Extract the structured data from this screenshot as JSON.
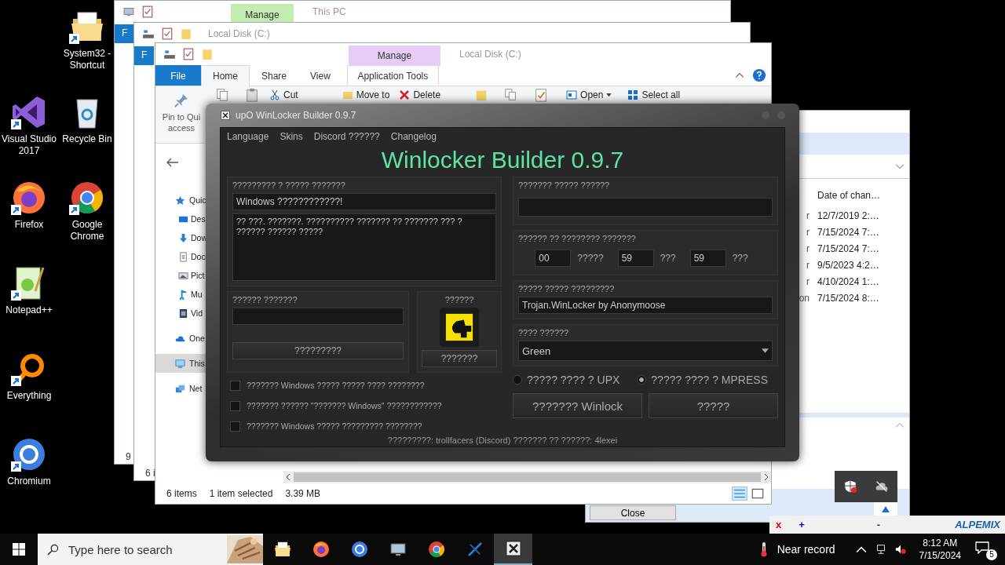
{
  "desktop_icons": [
    {
      "kind": "folder",
      "label": "System32 - Shortcut"
    },
    {
      "kind": "visual-studio",
      "label": "Visual Studio 2017"
    },
    {
      "kind": "recycle-bin",
      "label": "Recycle Bin"
    },
    {
      "kind": "firefox",
      "label": "Firefox"
    },
    {
      "kind": "chrome",
      "label": "Google Chrome"
    },
    {
      "kind": "notepad",
      "label": "Notepad++"
    },
    {
      "kind": "search-ring",
      "label": "Everything"
    },
    {
      "kind": "chromium",
      "label": "Chromium"
    }
  ],
  "back_window_1": {
    "contextual_tab": "Manage",
    "title": "This PC",
    "file_tab": "F",
    "status": "9"
  },
  "back_window_2": {
    "title": "Local Disk (C:)",
    "file_tab": "F",
    "status": "6 i"
  },
  "right_window": {
    "column": "Date of chan…",
    "type_fragments": [
      "r",
      "r",
      "r",
      "r",
      "r",
      "on"
    ],
    "dates": [
      "12/7/2019 2:…",
      "7/15/2024 7:…",
      "7/15/2024 7:…",
      "9/5/2023 4:2…",
      "4/10/2024 1:…",
      "7/15/2024 8:…"
    ],
    "close_button": "Close"
  },
  "explorer": {
    "contextual_tab": "Manage",
    "title": "Local Disk (C:)",
    "tabs": [
      {
        "label": "File",
        "kind": "file",
        "selected": false
      },
      {
        "label": "Home",
        "kind": "tab",
        "selected": true
      },
      {
        "label": "Share",
        "kind": "tab",
        "selected": false
      },
      {
        "label": "View",
        "kind": "tab",
        "selected": false
      },
      {
        "label": "Application Tools",
        "kind": "tab",
        "selected": false
      }
    ],
    "ribbon": {
      "pin": "Pin to Qui",
      "pin_line2": "access",
      "cut": "Cut",
      "move_to": "Move to",
      "delete": "Delete",
      "open": "Open",
      "select_all": "Select all"
    },
    "nav": [
      {
        "label": "Quic",
        "kind": "star",
        "selected": false,
        "children": [
          {
            "label": "Des",
            "kind": "desktop",
            "selected": false
          },
          {
            "label": "Dow",
            "kind": "download",
            "selected": false
          },
          {
            "label": "Doc",
            "kind": "document",
            "selected": false
          },
          {
            "label": "Pict",
            "kind": "picture",
            "selected": false
          },
          {
            "label": "Mu",
            "kind": "music",
            "selected": false
          },
          {
            "label": "Vid",
            "kind": "video",
            "selected": false
          }
        ]
      },
      {
        "label": "One",
        "kind": "cloud",
        "selected": false
      },
      {
        "label": "This",
        "kind": "pc",
        "selected": true
      },
      {
        "label": "Net",
        "kind": "network",
        "selected": false
      }
    ],
    "status": {
      "items": "6 items",
      "selection": "1 item selected",
      "size": "3.39 MB"
    }
  },
  "builder": {
    "title": "upO WinLocker Builder 0.9.7",
    "menu": [
      "Language",
      "Skins",
      "Discord ??????",
      "Changelog"
    ],
    "heading": "Winlocker Builder 0.9.7",
    "message_group": {
      "label": "????????? ? ????? ???????",
      "title_value": "Windows ????????????!",
      "body_value": "?? ???. ???????. ?????????? ??????? ?? ??????? ??? ? ?????? ?????? ?????"
    },
    "password_group": {
      "label": "?????? ???????",
      "button": "?????????"
    },
    "icon_group": {
      "label": "??????",
      "button": "???????"
    },
    "options": [
      {
        "label": "??????? Windows ????? ????? ???? ????????",
        "checked": false
      },
      {
        "label": "??????? ?????? \"??????? Windows\" ????????????",
        "checked": false
      },
      {
        "label": "??????? Windows ????? ????????? ????????",
        "checked": false
      }
    ],
    "unlock_group": {
      "label": "??????? ????? ??????"
    },
    "timer_group": {
      "label": "?????? ?? ???????? ???????",
      "fields": [
        {
          "value": "00",
          "unit": "?????"
        },
        {
          "value": "59",
          "unit": "???"
        },
        {
          "value": "59",
          "unit": "???"
        }
      ]
    },
    "name_group": {
      "label": "????? ????? ?????????",
      "value": "Trojan.WinLocker by Anonymoose"
    },
    "skin_group": {
      "label": "???? ??????",
      "value": "Green"
    },
    "packers": [
      {
        "label": "????? ???? ? UPX",
        "selected": false
      },
      {
        "label": "????? ???? ? MPRESS",
        "selected": true
      }
    ],
    "buttons": [
      "??????? Winlock",
      "?????"
    ],
    "footer": "?????????: trollfacers (Discord) ??????? ?? ??????: 4lexei"
  },
  "remote_bar": {
    "buttons": [
      "x",
      "+",
      "-"
    ],
    "logo": "ALPEMIX"
  },
  "taskbar": {
    "search_placeholder": "Type here to search",
    "apps": [
      {
        "kind": "folder",
        "selected": false
      },
      {
        "kind": "firefox",
        "selected": false
      },
      {
        "kind": "chromium",
        "selected": false
      },
      {
        "kind": "monitor",
        "selected": false
      },
      {
        "kind": "chrome",
        "selected": false
      },
      {
        "kind": "x-app",
        "selected": false
      },
      {
        "kind": "builder",
        "selected": true
      }
    ],
    "weather": "Near record",
    "time": "8:12 AM",
    "date": "7/15/2024",
    "notifications": "5"
  }
}
